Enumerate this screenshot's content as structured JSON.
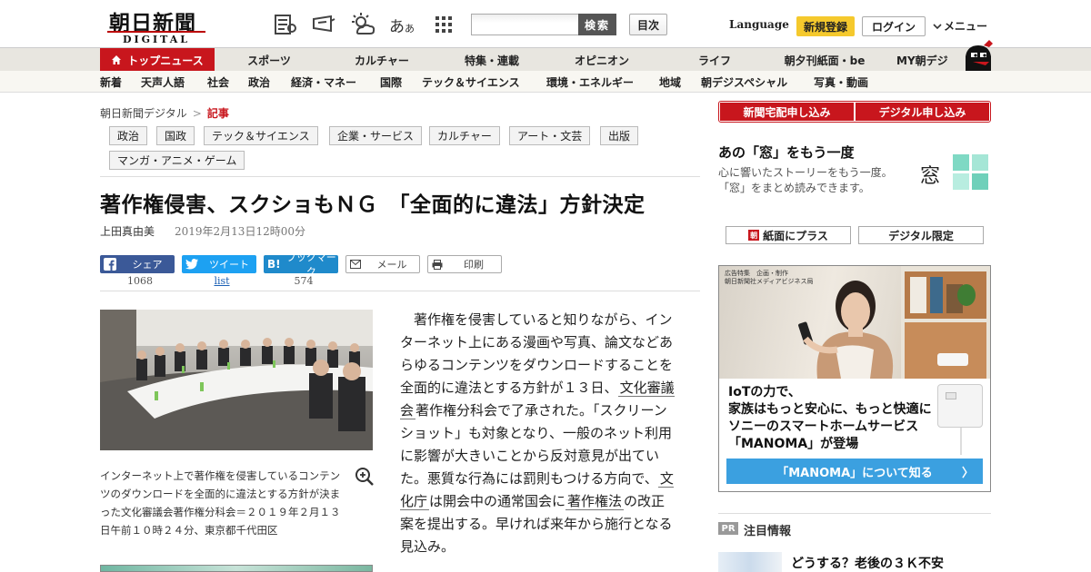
{
  "header": {
    "logo_main": "朝日新聞",
    "logo_sub": "DIGITAL",
    "search_button": "検索",
    "toc_button": "目次",
    "language": "Language",
    "signup": "新規登録",
    "login": "ログイン",
    "menu": "メニュー",
    "font_size_glyph_big": "あ",
    "font_size_glyph_small": "あ"
  },
  "nav": {
    "items": [
      "トップニュース",
      "スポーツ",
      "カルチャー",
      "特集・連載",
      "オピニオン",
      "ライフ",
      "朝夕刊紙面・be",
      "MY朝デジ"
    ]
  },
  "subnav": {
    "items": [
      "新着",
      "天声人語",
      "社会",
      "政治",
      "経済・マネー",
      "国際",
      "テック＆サイエンス",
      "環境・エネルギー",
      "地域",
      "朝デジスペシャル",
      "写真・動画"
    ]
  },
  "breadcrumb": {
    "home": "朝日新聞デジタル",
    "separator": ">",
    "current": "記事"
  },
  "tags": [
    "政治",
    "国政",
    "テック＆サイエンス",
    "企業・サービス",
    "カルチャー",
    "アート・文芸",
    "出版",
    "マンガ・アニメ・ゲーム"
  ],
  "article": {
    "title": "著作権侵害、スクショもＮＧ　「全面的に違法」方針決定",
    "author": "上田真由美",
    "date": "2019年2月13日12時00分",
    "photo_caption": "インターネット上で著作権を侵害しているコンテンツのダウンロードを全面的に違法とする方針が決まった文化審議会著作権分科会＝２０１９年２月１３日午前１０時２４分、東京都千代田区",
    "body_1": "著作権を侵害していると知りながら、インターネット上にある漫画や写真、論文などあらゆるコンテンツをダウンロードすることを全面的に違法とする方針が１３日、",
    "link_1": "文化審議会",
    "body_2": "著作権分科会で了承された。「スクリーンショット」も対象となり、一般のネット利用に影響が大きいことから反対意見が出ていた。悪質な行為には罰則もつける方向で、",
    "link_2": "文化庁",
    "body_3": "は開会中の通常国会に",
    "link_3": "著作権法",
    "body_4": "の改正案を提出する。早ければ来年から施行となる見込み。"
  },
  "share": {
    "facebook_label": "シェア",
    "facebook_count": "1068",
    "twitter_label": "ツイート",
    "twitter_count": "list",
    "hatena_label": "ブックマーク",
    "hatena_icon": "B!",
    "hatena_count": "574",
    "mail_label": "メール",
    "print_label": "印刷"
  },
  "sidebar": {
    "subscribe_paper": "新聞宅配申し込み",
    "subscribe_digital": "デジタル申し込み",
    "mado_title": "あの「窓」をもう一度",
    "mado_desc": "心に響いたストーリーをもう一度。「窓」をまとめ読みできます。",
    "mado_logo_char": "窓",
    "plus_paper": "紙面にプラス",
    "plus_icon_char": "朝",
    "digital_only": "デジタル限定",
    "pr_badge": "PR",
    "pr_title": "注目情報",
    "pr_item": "どうする？老後の３Ｋ不安"
  },
  "ad": {
    "meta_1": "広告特集　企画・制作",
    "meta_2": "朝日新聞社メディアビジネス局",
    "headline_1": "IoTの力で、",
    "headline_2": "家族はもっと安心に、もっと快適に",
    "headline_3": "ソニーのスマートホームサービス",
    "headline_4": "「MANOMA」が登場",
    "cta": "「MANOMA」について知る",
    "cta_arrow": "〉"
  },
  "colors": {
    "brand_red": "#c8161d",
    "signup_yellow": "#f5c92d",
    "facebook": "#3b5998",
    "twitter": "#1da1f2",
    "hatena": "#1f8acb",
    "ad_cta": "#3ba0e0"
  }
}
